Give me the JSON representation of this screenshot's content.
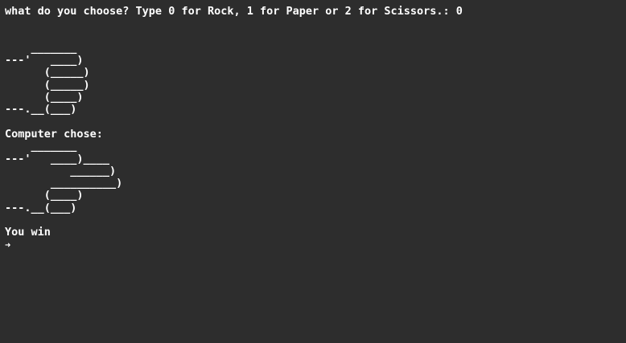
{
  "terminal": {
    "prompt_line": "what do you choose? Type 0 for Rock, 1 for Paper or 2 for Scissors.: 0",
    "user_art": [
      "",
      "",
      "    _______",
      "---'   ____)",
      "      (_____)",
      "      (_____)",
      "      (____)",
      "---.__(___)",
      "",
      "Computer chose:"
    ],
    "computer_art": [
      "    _______",
      "---'   ____)____",
      "          ______)",
      "       __________)",
      "      (____)",
      "---.__(___)",
      ""
    ],
    "result": "You win",
    "cursor_symbol": "➜"
  }
}
